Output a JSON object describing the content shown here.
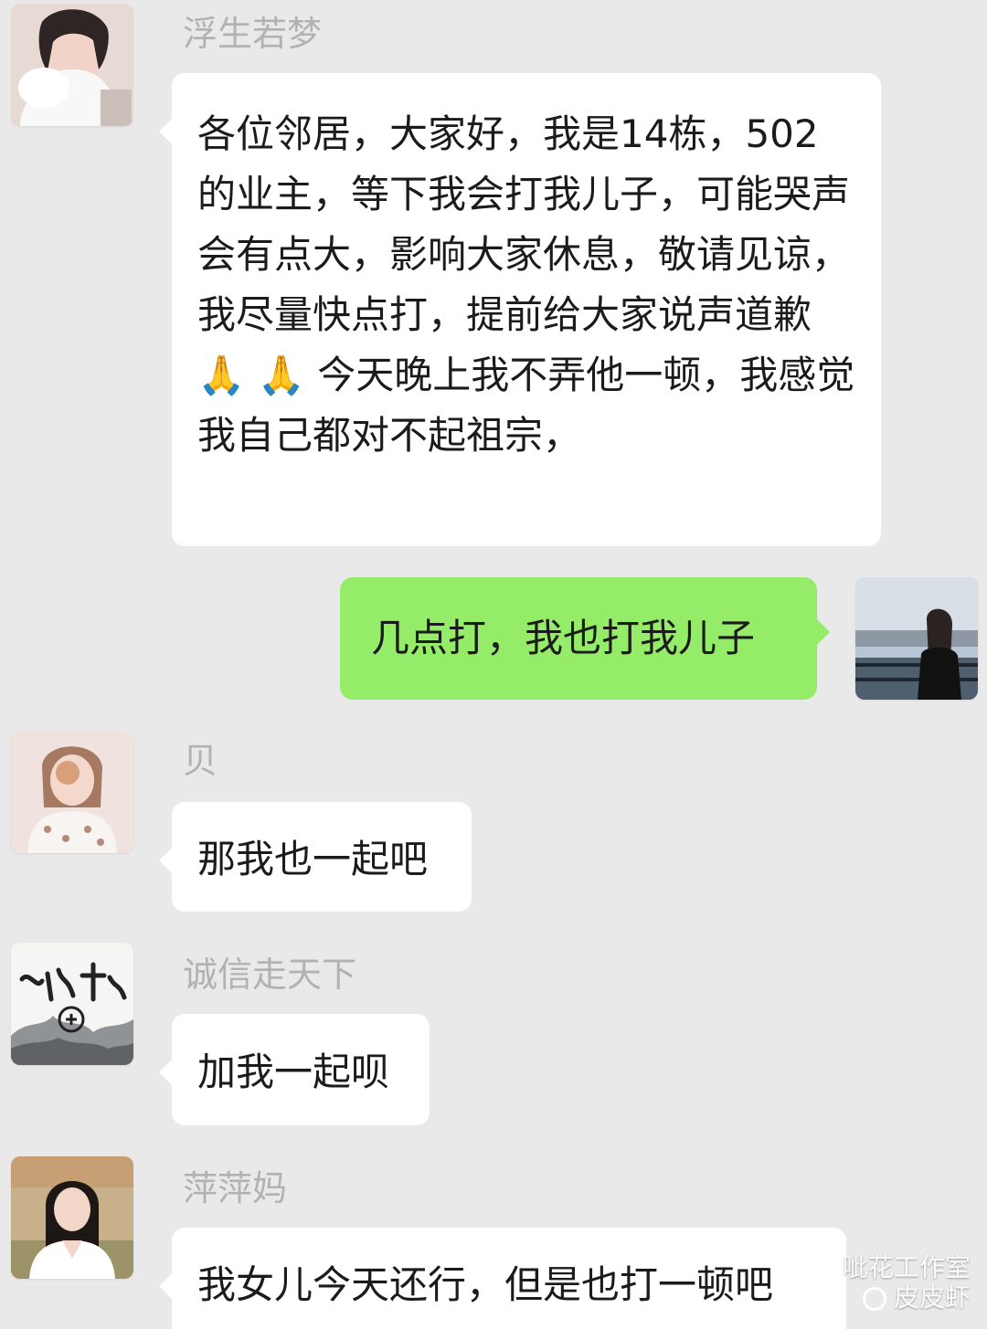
{
  "messages": [
    {
      "sender": "浮生若梦",
      "text": "各位邻居，大家好，我是14栋，502的业主，等下我会打我儿子，可能哭声会有点大，影响大家休息，敬请见谅，我尽量快点打，提前给大家说声道歉🙏 🙏 今天晚上我不弄他一顿，我感觉我自己都对不起祖宗，",
      "avatar_icon": "woman-avatar-icon"
    },
    {
      "text": "几点打，我也打我儿子",
      "avatar_icon": "woman-outdoor-avatar-icon"
    },
    {
      "sender": "贝",
      "text": "那我也一起吧",
      "avatar_icon": "girl-avatar-icon"
    },
    {
      "sender": "诚信走天下",
      "text": "加我一起呗",
      "avatar_icon": "calligraphy-avatar-icon"
    },
    {
      "sender": "萍萍妈",
      "text": "我女儿今天还行，但是也打一顿吧",
      "avatar_icon": "portrait-avatar-icon"
    }
  ],
  "watermark": {
    "line1": "呲花工作室",
    "line2": "皮皮虾"
  },
  "colors": {
    "background": "#e9e9e9",
    "incoming_bubble": "#ffffff",
    "outgoing_bubble": "#95ec69",
    "sender_name": "#b2b2b2"
  }
}
